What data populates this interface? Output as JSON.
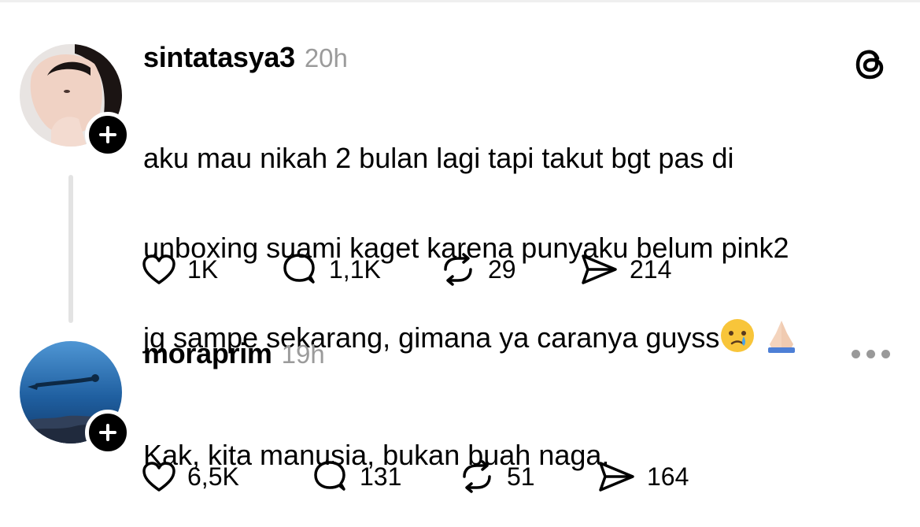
{
  "posts": [
    {
      "username": "sintatasya3",
      "time": "20h",
      "text_lines": [
        "aku mau nikah 2 bulan lagi tapi takut bgt pas di",
        "unboxing suami kaget karena punyaku belum pink2",
        "jg sampe sekarang, gimana ya caranya guyss"
      ],
      "emojis": [
        "crying-face-emoji",
        "folded-hands-emoji"
      ],
      "likes": "1K",
      "replies": "1,1K",
      "reposts": "29",
      "shares": "214"
    },
    {
      "username": "moraprim",
      "time": "19h",
      "text_lines": [
        "Kak, kita manusia, bukan buah naga."
      ],
      "likes": "6,5K",
      "replies": "131",
      "reposts": "51",
      "shares": "164"
    }
  ],
  "icons": {
    "app_logo": "threads-logo-icon",
    "more": "more-options-icon",
    "like": "heart-icon",
    "reply": "comment-icon",
    "repost": "repost-icon",
    "share": "send-icon",
    "follow": "plus-icon"
  }
}
